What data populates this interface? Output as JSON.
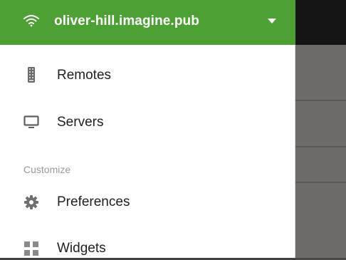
{
  "header": {
    "account_name": "oliver-hill.imagine.pub",
    "icon": "wifi-icon",
    "dropdown_icon": "triangle-down-icon",
    "background_color": "#4da033"
  },
  "menu": {
    "items": [
      {
        "label": "Remotes",
        "icon": "remote-icon"
      },
      {
        "label": "Servers",
        "icon": "monitor-icon"
      }
    ],
    "sections": [
      {
        "title": "Customize",
        "items": [
          {
            "label": "Preferences",
            "icon": "gear-icon"
          },
          {
            "label": "Widgets",
            "icon": "widgets-grid-icon"
          }
        ]
      }
    ]
  }
}
